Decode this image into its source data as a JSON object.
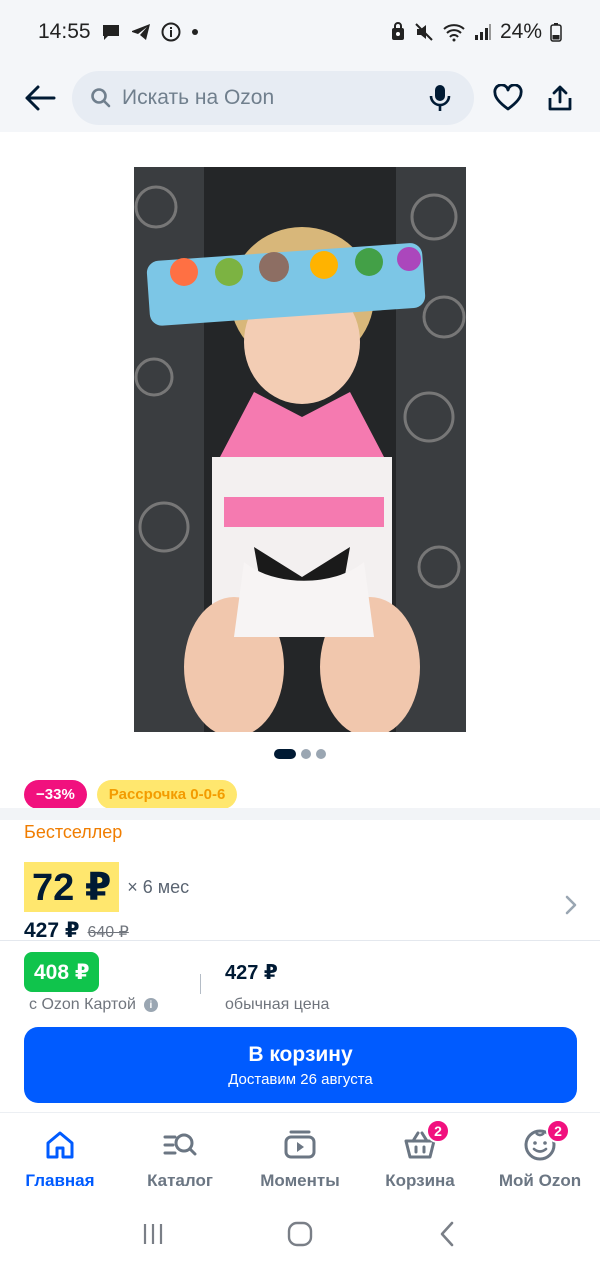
{
  "status_bar": {
    "time": "14:55",
    "battery": "24%"
  },
  "search": {
    "placeholder": "Искать на Ozon"
  },
  "product": {
    "image_count": 3,
    "active_image": 1,
    "discount_badge": "−33%",
    "installment_badge": "Рассрочка 0-0-6",
    "label": "Бестселлер",
    "installment_price": "72 ₽",
    "installment_months": "× 6 мес",
    "price": "427 ₽",
    "old_price": "640 ₽",
    "card_price": "408 ₽",
    "card_caption": "с Ozon Картой",
    "regular_price": "427 ₽",
    "regular_caption": "обычная цена"
  },
  "cart_button": {
    "title": "В корзину",
    "subtitle": "Доставим 26 августа"
  },
  "bottom_nav": {
    "items": [
      {
        "label": "Главная",
        "icon": "home-icon"
      },
      {
        "label": "Каталог",
        "icon": "catalog-icon"
      },
      {
        "label": "Моменты",
        "icon": "moments-icon"
      },
      {
        "label": "Корзина",
        "icon": "cart-icon",
        "badge": "2"
      },
      {
        "label": "Мой Ozon",
        "icon": "profile-icon",
        "badge": "2"
      }
    ]
  },
  "colors": {
    "accent": "#005bff",
    "discount": "#f1117e",
    "card_price": "#10c44c",
    "highlight": "#ffe76e"
  }
}
